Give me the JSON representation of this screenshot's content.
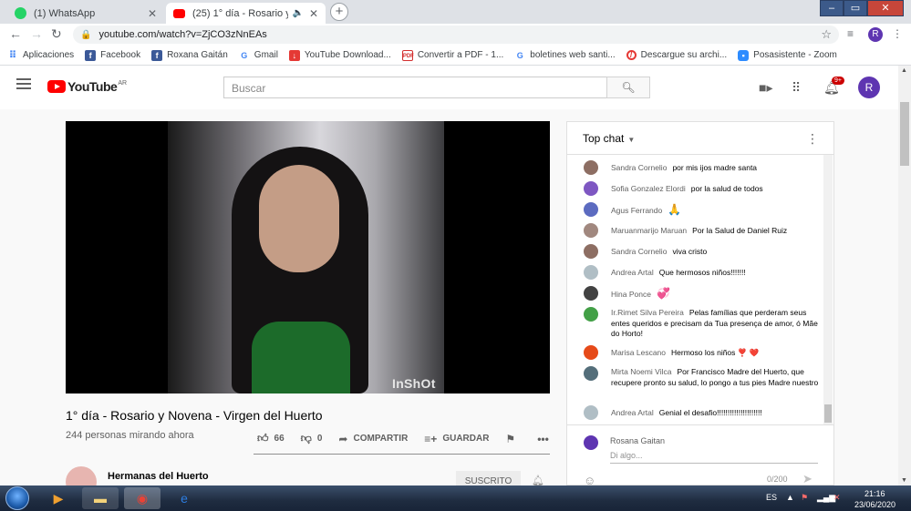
{
  "browser": {
    "tabs": [
      {
        "title": "(1) WhatsApp",
        "icon": "whatsapp-icon",
        "color": "#25d366"
      },
      {
        "title": "(25) 1° día - Rosario y Novena",
        "icon": "youtube-icon",
        "color": "#ff0000"
      }
    ],
    "new_tab_label": "+",
    "url": "youtube.com/watch?v=ZjCO3zNnEAs",
    "profile_initial": "R"
  },
  "bookmarks": [
    {
      "label": "Aplicaciones",
      "icon": "apps-grid-icon",
      "color": "#4285f4"
    },
    {
      "label": "Facebook",
      "icon": "facebook-icon",
      "color": "#3b5998"
    },
    {
      "label": "Roxana Gaitán",
      "icon": "facebook-icon",
      "color": "#3b5998"
    },
    {
      "label": "Gmail",
      "icon": "google-icon",
      "color": "#4285f4"
    },
    {
      "label": "YouTube Download...",
      "icon": "download-icon",
      "color": "#e53935"
    },
    {
      "label": "Convertir a PDF - 1...",
      "icon": "pdf-icon",
      "color": "#d32f2f"
    },
    {
      "label": "boletines web santi...",
      "icon": "google-icon",
      "color": "#4285f4"
    },
    {
      "label": "Descargue su archi...",
      "icon": "block-icon",
      "color": "#e53935"
    },
    {
      "label": "Posasistente - Zoom",
      "icon": "zoom-icon",
      "color": "#2d8cff"
    }
  ],
  "youtube": {
    "logo_text": "YouTube",
    "region": "AR",
    "search_placeholder": "Buscar",
    "notification_count": "9+",
    "avatar_initial": "R"
  },
  "video": {
    "title": "1° día - Rosario y Novena - Virgen del Huerto",
    "viewers": "244 personas mirando ahora",
    "watermark": "InShOt",
    "likes": "66",
    "dislikes": "0",
    "share_label": "COMPARTIR",
    "save_label": "GUARDAR",
    "channel": "Hermanas del Huerto",
    "subscribed_label": "SUSCRITO"
  },
  "chat": {
    "header": "Top chat",
    "messages": [
      {
        "author": "Sandra Cornelio",
        "text": "por mis ijos madre santa",
        "avatar_color": "#8d6e63"
      },
      {
        "author": "Sofia Gonzalez Elordi",
        "text": "por la salud de todos",
        "avatar_color": "#7e57c2"
      },
      {
        "author": "Agus Ferrando",
        "text": "🙏",
        "avatar_color": "#5c6bc0"
      },
      {
        "author": "Maruanmarijo Maruan",
        "text": "Por la Salud de Daniel Ruiz",
        "avatar_color": "#a1887f"
      },
      {
        "author": "Sandra Cornelio",
        "text": "viva cristo",
        "avatar_color": "#8d6e63"
      },
      {
        "author": "Andrea Artal",
        "text": "Que hermosos niños!!!!!!!",
        "avatar_color": "#b0bec5"
      },
      {
        "author": "Hina Ponce",
        "text": "💞",
        "avatar_color": "#424242"
      },
      {
        "author": "Ir.Rimet Silva Pereira",
        "text": "Pelas famílias que perderam seus entes queridos e precisam da Tua presença de amor, ó Mãe do Horto!",
        "avatar_color": "#43a047"
      },
      {
        "author": "Marisa Lescano",
        "text": "Hermoso los niños ❣️ ❤️",
        "avatar_color": "#e64a19"
      },
      {
        "author": "Mirta Noemi Vilca",
        "text": "Por Francisco Madre del Huerto, que recupere pronto su salud, lo pongo a tus pies Madre nuestro",
        "avatar_color": "#546e7a"
      },
      {
        "author": "Andrea Artal",
        "text": "Genial el desafio!!!!!!!!!!!!!!!!!!!!!",
        "avatar_color": "#b0bec5"
      }
    ],
    "composer_name": "Rosana Gaitan",
    "composer_placeholder": "Di algo...",
    "char_count": "0/200"
  },
  "taskbar": {
    "language": "ES",
    "time": "21:16",
    "date": "23/06/2020"
  }
}
